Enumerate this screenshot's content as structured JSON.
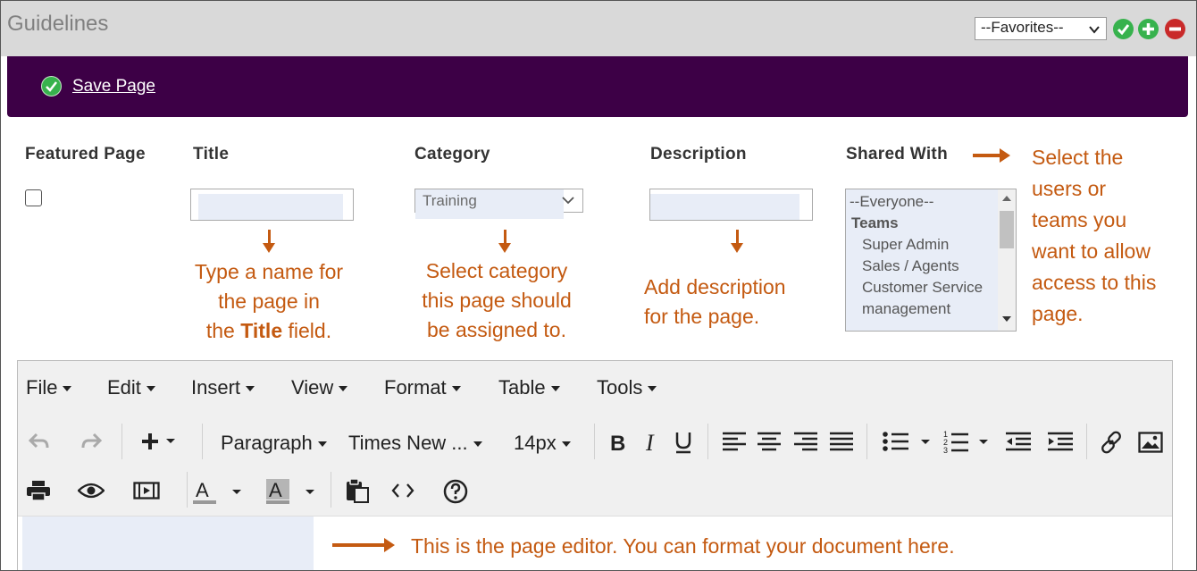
{
  "header": {
    "title": "Guidelines",
    "favorites_value": "--Favorites--"
  },
  "savebar": {
    "save_label": "Save Page"
  },
  "form": {
    "featured_label": "Featured Page",
    "title_label": "Title",
    "category_label": "Category",
    "category_value": "Training",
    "description_label": "Description",
    "shared_label": "Shared With",
    "shared_options": [
      "--Everyone--",
      "Teams",
      "Super Admin",
      "Sales / Agents",
      "Customer Service",
      "management"
    ]
  },
  "annotations": {
    "title_lines": [
      "Type a name for",
      "the page in"
    ],
    "title_line3_prefix": "the ",
    "title_line3_bold": "Title",
    "title_line3_suffix": " field.",
    "category_lines": [
      "Select category",
      "this page should",
      "be assigned to."
    ],
    "description_lines": [
      "Add description",
      "for the page."
    ],
    "shared_lines": [
      "Select the",
      "users or",
      "teams you",
      "want to allow",
      "access to this",
      "page."
    ],
    "editor": "This is the page editor. You can format your document here."
  },
  "editor": {
    "menus": [
      "File",
      "Edit",
      "Insert",
      "View",
      "Format",
      "Table",
      "Tools"
    ],
    "block_format": "Paragraph",
    "font_family": "Times New ...",
    "font_size": "14px"
  },
  "colors": {
    "accent_purple": "#3d0046",
    "annotation_orange": "#c45a11",
    "success_green": "#37b24d",
    "danger_red": "#c92a2a"
  }
}
